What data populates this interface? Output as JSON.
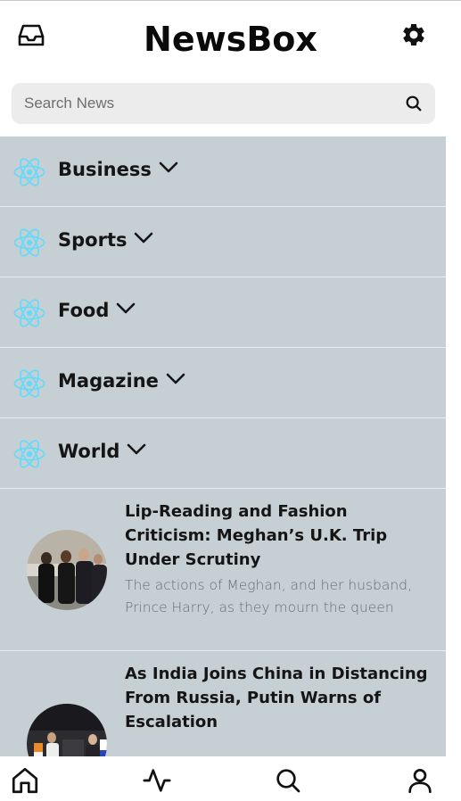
{
  "app": {
    "title": "NewsBox"
  },
  "header": {
    "left_icon": "inbox-icon",
    "right_icon": "gear-icon"
  },
  "search": {
    "placeholder": "Search News",
    "value": "",
    "icon": "search-icon"
  },
  "categories": [
    {
      "label": "Business",
      "icon": "react-logo-icon"
    },
    {
      "label": "Sports",
      "icon": "react-logo-icon"
    },
    {
      "label": "Food",
      "icon": "react-logo-icon"
    },
    {
      "label": "Magazine",
      "icon": "react-logo-icon"
    },
    {
      "label": "World",
      "icon": "react-logo-icon"
    }
  ],
  "articles": [
    {
      "title": "Lip-Reading and Fashion Criticism: Meghan’s U.K. Trip Under Scrutiny",
      "description": "The actions of Meghan, and her husband, Prince Harry, as they mourn the queen"
    },
    {
      "title": "As India Joins China in Distancing From Russia, Putin Warns of Escalation",
      "description": ""
    }
  ],
  "tabbar": {
    "items": [
      {
        "name": "home",
        "icon": "home-icon"
      },
      {
        "name": "activity",
        "icon": "activity-icon"
      },
      {
        "name": "search",
        "icon": "search-icon"
      },
      {
        "name": "profile",
        "icon": "user-icon"
      }
    ]
  },
  "colors": {
    "panel_bg": "#c6cfd3",
    "search_bg": "#ececec",
    "react_logo": "#61dafb",
    "text": "#151515",
    "muted_text": "#6a6d70"
  }
}
